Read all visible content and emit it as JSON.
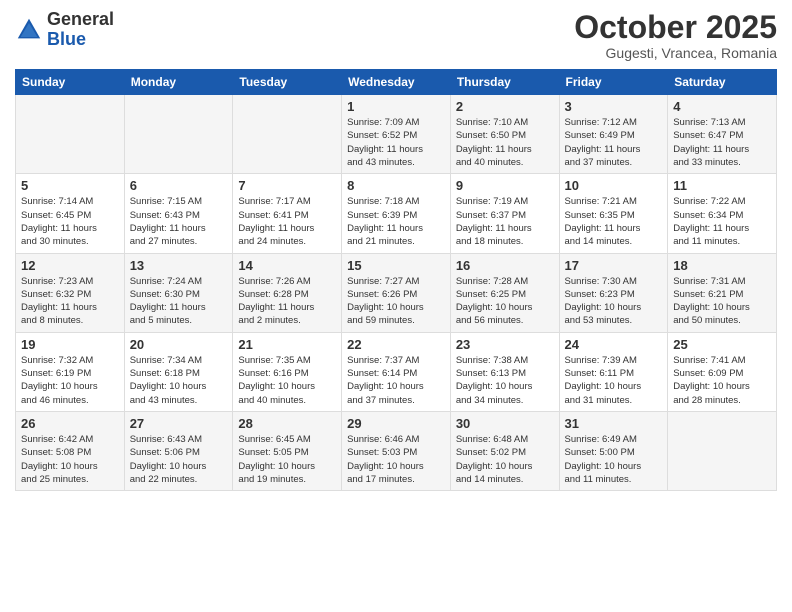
{
  "logo": {
    "general": "General",
    "blue": "Blue"
  },
  "header": {
    "month": "October 2025",
    "location": "Gugesti, Vrancea, Romania"
  },
  "weekdays": [
    "Sunday",
    "Monday",
    "Tuesday",
    "Wednesday",
    "Thursday",
    "Friday",
    "Saturday"
  ],
  "rows": [
    [
      {
        "day": "",
        "info": ""
      },
      {
        "day": "",
        "info": ""
      },
      {
        "day": "",
        "info": ""
      },
      {
        "day": "1",
        "info": "Sunrise: 7:09 AM\nSunset: 6:52 PM\nDaylight: 11 hours\nand 43 minutes."
      },
      {
        "day": "2",
        "info": "Sunrise: 7:10 AM\nSunset: 6:50 PM\nDaylight: 11 hours\nand 40 minutes."
      },
      {
        "day": "3",
        "info": "Sunrise: 7:12 AM\nSunset: 6:49 PM\nDaylight: 11 hours\nand 37 minutes."
      },
      {
        "day": "4",
        "info": "Sunrise: 7:13 AM\nSunset: 6:47 PM\nDaylight: 11 hours\nand 33 minutes."
      }
    ],
    [
      {
        "day": "5",
        "info": "Sunrise: 7:14 AM\nSunset: 6:45 PM\nDaylight: 11 hours\nand 30 minutes."
      },
      {
        "day": "6",
        "info": "Sunrise: 7:15 AM\nSunset: 6:43 PM\nDaylight: 11 hours\nand 27 minutes."
      },
      {
        "day": "7",
        "info": "Sunrise: 7:17 AM\nSunset: 6:41 PM\nDaylight: 11 hours\nand 24 minutes."
      },
      {
        "day": "8",
        "info": "Sunrise: 7:18 AM\nSunset: 6:39 PM\nDaylight: 11 hours\nand 21 minutes."
      },
      {
        "day": "9",
        "info": "Sunrise: 7:19 AM\nSunset: 6:37 PM\nDaylight: 11 hours\nand 18 minutes."
      },
      {
        "day": "10",
        "info": "Sunrise: 7:21 AM\nSunset: 6:35 PM\nDaylight: 11 hours\nand 14 minutes."
      },
      {
        "day": "11",
        "info": "Sunrise: 7:22 AM\nSunset: 6:34 PM\nDaylight: 11 hours\nand 11 minutes."
      }
    ],
    [
      {
        "day": "12",
        "info": "Sunrise: 7:23 AM\nSunset: 6:32 PM\nDaylight: 11 hours\nand 8 minutes."
      },
      {
        "day": "13",
        "info": "Sunrise: 7:24 AM\nSunset: 6:30 PM\nDaylight: 11 hours\nand 5 minutes."
      },
      {
        "day": "14",
        "info": "Sunrise: 7:26 AM\nSunset: 6:28 PM\nDaylight: 11 hours\nand 2 minutes."
      },
      {
        "day": "15",
        "info": "Sunrise: 7:27 AM\nSunset: 6:26 PM\nDaylight: 10 hours\nand 59 minutes."
      },
      {
        "day": "16",
        "info": "Sunrise: 7:28 AM\nSunset: 6:25 PM\nDaylight: 10 hours\nand 56 minutes."
      },
      {
        "day": "17",
        "info": "Sunrise: 7:30 AM\nSunset: 6:23 PM\nDaylight: 10 hours\nand 53 minutes."
      },
      {
        "day": "18",
        "info": "Sunrise: 7:31 AM\nSunset: 6:21 PM\nDaylight: 10 hours\nand 50 minutes."
      }
    ],
    [
      {
        "day": "19",
        "info": "Sunrise: 7:32 AM\nSunset: 6:19 PM\nDaylight: 10 hours\nand 46 minutes."
      },
      {
        "day": "20",
        "info": "Sunrise: 7:34 AM\nSunset: 6:18 PM\nDaylight: 10 hours\nand 43 minutes."
      },
      {
        "day": "21",
        "info": "Sunrise: 7:35 AM\nSunset: 6:16 PM\nDaylight: 10 hours\nand 40 minutes."
      },
      {
        "day": "22",
        "info": "Sunrise: 7:37 AM\nSunset: 6:14 PM\nDaylight: 10 hours\nand 37 minutes."
      },
      {
        "day": "23",
        "info": "Sunrise: 7:38 AM\nSunset: 6:13 PM\nDaylight: 10 hours\nand 34 minutes."
      },
      {
        "day": "24",
        "info": "Sunrise: 7:39 AM\nSunset: 6:11 PM\nDaylight: 10 hours\nand 31 minutes."
      },
      {
        "day": "25",
        "info": "Sunrise: 7:41 AM\nSunset: 6:09 PM\nDaylight: 10 hours\nand 28 minutes."
      }
    ],
    [
      {
        "day": "26",
        "info": "Sunrise: 6:42 AM\nSunset: 5:08 PM\nDaylight: 10 hours\nand 25 minutes."
      },
      {
        "day": "27",
        "info": "Sunrise: 6:43 AM\nSunset: 5:06 PM\nDaylight: 10 hours\nand 22 minutes."
      },
      {
        "day": "28",
        "info": "Sunrise: 6:45 AM\nSunset: 5:05 PM\nDaylight: 10 hours\nand 19 minutes."
      },
      {
        "day": "29",
        "info": "Sunrise: 6:46 AM\nSunset: 5:03 PM\nDaylight: 10 hours\nand 17 minutes."
      },
      {
        "day": "30",
        "info": "Sunrise: 6:48 AM\nSunset: 5:02 PM\nDaylight: 10 hours\nand 14 minutes."
      },
      {
        "day": "31",
        "info": "Sunrise: 6:49 AM\nSunset: 5:00 PM\nDaylight: 10 hours\nand 11 minutes."
      },
      {
        "day": "",
        "info": ""
      }
    ]
  ]
}
